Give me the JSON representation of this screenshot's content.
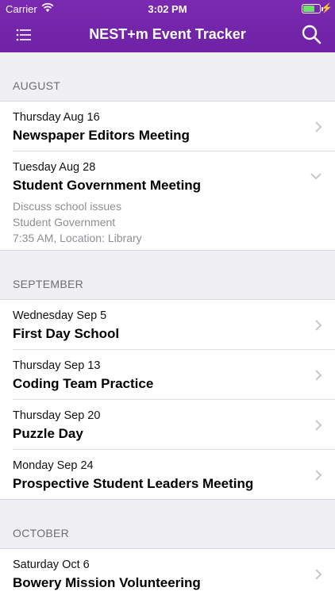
{
  "status_bar": {
    "carrier": "Carrier",
    "time": "3:02 PM",
    "battery_level": 0.7
  },
  "navbar": {
    "title": "NEST+m Event Tracker"
  },
  "sections": [
    {
      "header": "AUGUST",
      "events": [
        {
          "date": "Thursday Aug 16",
          "name": "Newspaper Editors Meeting"
        },
        {
          "date": "Tuesday Aug 28",
          "name": "Student Government Meeting",
          "details": [
            "Discuss school issues",
            "Student Government",
            "7:35 AM, Location: Library"
          ]
        }
      ]
    },
    {
      "header": "SEPTEMBER",
      "events": [
        {
          "date": "Wednesday Sep 5",
          "name": "First Day School"
        },
        {
          "date": "Thursday Sep 13",
          "name": "Coding Team Practice"
        },
        {
          "date": "Thursday Sep 20",
          "name": "Puzzle Day"
        },
        {
          "date": "Monday Sep 24",
          "name": "Prospective Student Leaders Meeting"
        }
      ]
    },
    {
      "header": "OCTOBER",
      "events": [
        {
          "date": "Saturday Oct 6",
          "name": "Bowery Mission Volunteering"
        }
      ]
    }
  ]
}
